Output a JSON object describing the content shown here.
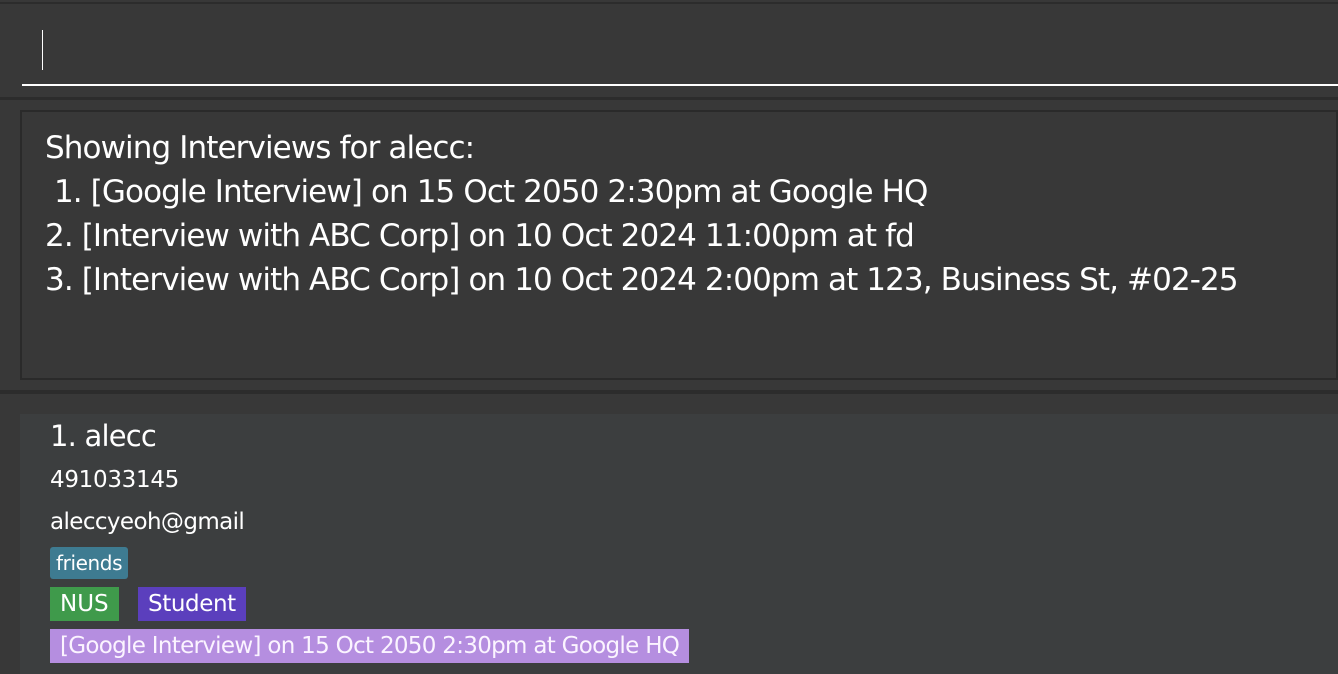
{
  "command_box": {
    "value": "",
    "placeholder": ""
  },
  "result_display": {
    "lines": [
      "Showing Interviews for alecc:",
      " 1. [Google Interview] on 15 Oct 2050 2:30pm at Google HQ",
      "2. [Interview with ABC Corp] on 10 Oct 2024 11:00pm at fd",
      "3. [Interview with ABC Corp] on 10 Oct 2024 2:00pm at 123, Business St, #02-25"
    ]
  },
  "person_list": {
    "persons": [
      {
        "name": "1. alecc",
        "phone": "491033145",
        "email": "aleccyeoh@gmail",
        "tags": {
          "friends": "friends",
          "nus": "NUS",
          "student": "Student",
          "interview": "[Google Interview] on 15 Oct 2050 2:30pm at Google HQ"
        }
      }
    ]
  },
  "colors": {
    "background": "#383838",
    "panel": "#3c3e3f",
    "tag_friends": "#3e7b91",
    "tag_nus": "#3f9a4b",
    "tag_student": "#5b3fbd",
    "tag_interview": "#b58ee0"
  }
}
